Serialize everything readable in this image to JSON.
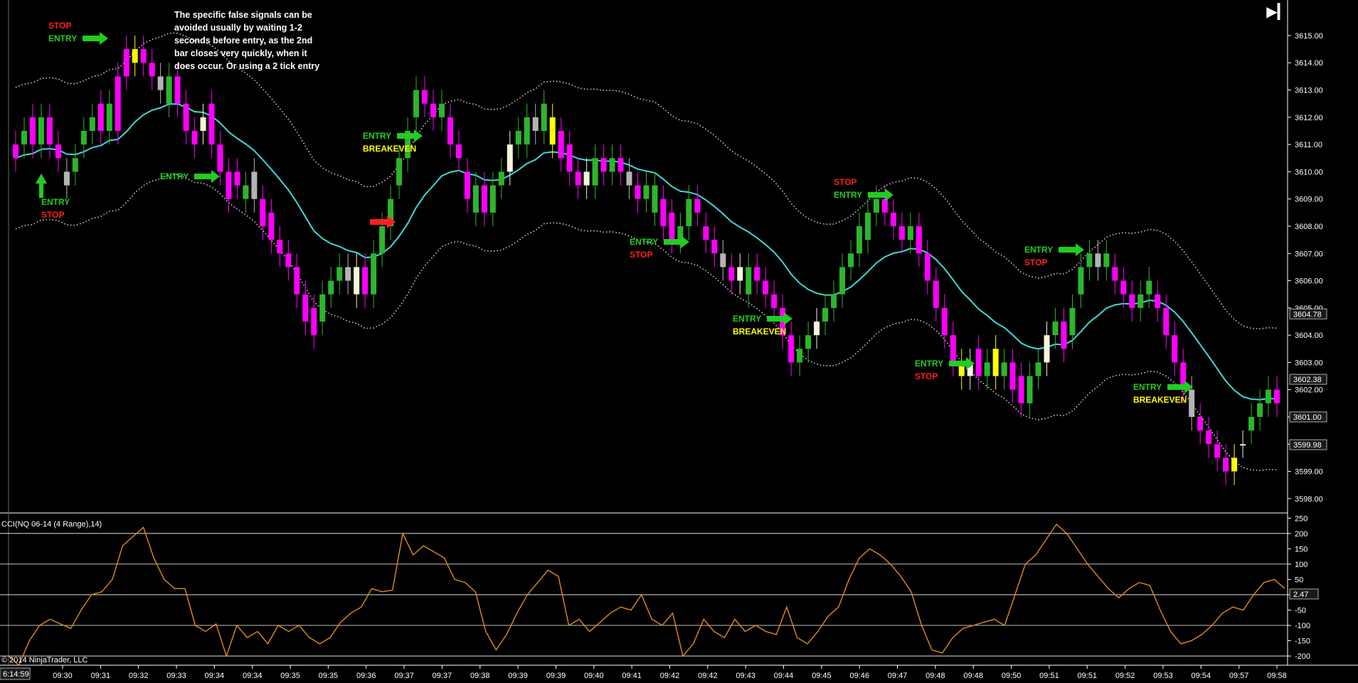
{
  "note_lines": [
    "The specific false signals can be",
    "avoided usually by waiting 1-2",
    "seconds before entry, as the 2nd",
    "bar closes very quickly, when it",
    "does occur.  Or using a 2 tick entry"
  ],
  "copyright": "© 2014 NinjaTrader, LLC",
  "clock": "6:14:59",
  "colors": {
    "bull": "#2db52d",
    "bear": "#ff00ff",
    "neutral_up": "#f5f5dc",
    "neutral_down": "#b4b4b4",
    "signal_bar": "#ffff00",
    "ema": "#40d8d8",
    "bands": "#d0d0d0",
    "cci": "#e08a1e",
    "entry": "#22cc22",
    "stop": "#ff2020",
    "breakeven": "#ffff00",
    "arrow_red": "#ff2020"
  },
  "annotations": [
    {
      "lines": [
        "STOP",
        "ENTRY"
      ],
      "colors": [
        "stop",
        "entry"
      ],
      "arrow": "right"
    },
    {
      "lines": [
        "ENTRY",
        "STOP"
      ],
      "colors": [
        "entry",
        "stop"
      ],
      "arrow": "up"
    },
    {
      "lines": [
        "ENTRY"
      ],
      "colors": [
        "entry"
      ],
      "arrow": "right"
    },
    {
      "lines": [
        "ENTRY",
        "BREAKEVEN"
      ],
      "colors": [
        "entry",
        "breakeven"
      ],
      "arrow": "right"
    },
    {
      "lines": [
        ""
      ],
      "colors": [
        "stop"
      ],
      "arrow": "right-red"
    },
    {
      "lines": [
        "ENTRY",
        "STOP"
      ],
      "colors": [
        "entry",
        "stop"
      ],
      "arrow": "right"
    },
    {
      "lines": [
        "ENTRY",
        "BREAKEVEN"
      ],
      "colors": [
        "entry",
        "breakeven"
      ],
      "arrow": "right"
    },
    {
      "lines": [
        "STOP",
        "ENTRY"
      ],
      "colors": [
        "stop",
        "entry"
      ],
      "arrow": "right"
    },
    {
      "lines": [
        "ENTRY",
        "STOP"
      ],
      "colors": [
        "entry",
        "stop"
      ],
      "arrow": "right"
    },
    {
      "lines": [
        "ENTRY",
        "STOP"
      ],
      "colors": [
        "entry",
        "stop"
      ],
      "arrow": "right"
    },
    {
      "lines": [
        "ENTRY",
        "BREAKEVEN"
      ],
      "colors": [
        "entry",
        "breakeven"
      ],
      "arrow": "right"
    }
  ],
  "chart_data": [
    {
      "type": "candlestick",
      "title": "",
      "ylim": [
        3597.5,
        3616.2
      ],
      "y_ticks": [
        3598.0,
        3599.0,
        3600.0,
        3601.0,
        3602.0,
        3603.0,
        3604.0,
        3605.0,
        3606.0,
        3607.0,
        3608.0,
        3609.0,
        3610.0,
        3611.0,
        3612.0,
        3613.0,
        3614.0,
        3615.0
      ],
      "price_markers": [
        3604.78,
        3602.38,
        3601.0,
        3599.98
      ],
      "x_ticks": [
        "09:30",
        "09:31",
        "09:32",
        "09:33",
        "09:34",
        "09:34",
        "09:35",
        "09:35",
        "09:36",
        "09:37",
        "09:37",
        "09:38",
        "09:39",
        "09:39",
        "09:40",
        "09:41",
        "09:42",
        "09:42",
        "09:43",
        "09:44",
        "09:45",
        "09:46",
        "09:47",
        "09:48",
        "09:48",
        "09:50",
        "09:51",
        "09:51",
        "09:52",
        "09:53",
        "09:54",
        "09:57",
        "09:58"
      ],
      "candles_close": [
        3610.5,
        3611.5,
        3611.0,
        3612.0,
        3611.0,
        3610.5,
        3609.5,
        3610.5,
        3611.5,
        3612.0,
        3611.5,
        3612.5,
        3611.5,
        3613.5,
        3614.5,
        3614.0,
        3613.5,
        3613.0,
        3613.5,
        3612.5,
        3611.5,
        3611.0,
        3612.0,
        3611.0,
        3610.0,
        3609.0,
        3609.5,
        3609.5,
        3609.0,
        3608.0,
        3607.5,
        3607.0,
        3606.5,
        3605.5,
        3604.5,
        3604.0,
        3605.5,
        3606.0,
        3606.5,
        3606.0,
        3606.5,
        3605.5,
        3607.0,
        3608.0,
        3609.0,
        3610.5,
        3611.5,
        3613.0,
        3612.5,
        3612.0,
        3612.5,
        3611.0,
        3610.5,
        3609.0,
        3609.5,
        3608.5,
        3609.5,
        3610.0,
        3611.0,
        3611.5,
        3612.0,
        3611.5,
        3612.5,
        3611.0,
        3610.5,
        3610.0,
        3609.5,
        3610.0,
        3610.5,
        3610.0,
        3610.5,
        3610.0,
        3609.5,
        3609.0,
        3609.5,
        3609.5,
        3608.0,
        3607.5,
        3608.0,
        3609.0,
        3608.5,
        3607.5,
        3607.0,
        3606.5,
        3606.0,
        3606.5,
        3606.5,
        3606.0,
        3605.5,
        3605.0,
        3604.0,
        3603.0,
        3603.5,
        3604.0,
        3604.5,
        3605.0,
        3605.5,
        3606.5,
        3607.0,
        3608.0,
        3608.5,
        3609.0,
        3608.5,
        3608.0,
        3607.5,
        3608.0,
        3607.0,
        3606.0,
        3605.0,
        3604.0,
        3603.0,
        3602.5,
        3603.0,
        3602.5,
        3603.0,
        3602.5,
        3603.0,
        3602.0,
        3601.5,
        3602.5,
        3603.0,
        3604.0,
        3604.5,
        3603.5,
        3605.0,
        3606.5,
        3607.0,
        3606.5,
        3607.0,
        3606.0,
        3605.5,
        3605.0,
        3605.5,
        3606.0,
        3605.0,
        3604.0,
        3603.0,
        3602.0,
        3601.0,
        3600.5,
        3600.0,
        3599.5,
        3599.0,
        3599.5,
        3600.0,
        3601.0,
        3601.5,
        3602.0,
        3601.5
      ],
      "candles_open": [
        3611.0,
        3611.0,
        3612.0,
        3611.0,
        3612.0,
        3611.0,
        3610.0,
        3610.0,
        3611.0,
        3611.5,
        3612.5,
        3611.5,
        3613.5,
        3614.5,
        3614.0,
        3614.5,
        3614.0,
        3613.5,
        3612.5,
        3613.5,
        3612.5,
        3611.5,
        3611.5,
        3612.5,
        3611.0,
        3610.0,
        3610.0,
        3609.0,
        3610.0,
        3609.0,
        3608.5,
        3607.5,
        3607.0,
        3606.5,
        3605.5,
        3605.0,
        3604.5,
        3605.5,
        3606.0,
        3606.5,
        3605.5,
        3606.5,
        3605.5,
        3607.0,
        3608.0,
        3609.5,
        3610.5,
        3612.0,
        3613.0,
        3612.5,
        3612.0,
        3612.0,
        3611.0,
        3610.0,
        3608.5,
        3609.5,
        3608.5,
        3609.5,
        3610.0,
        3611.0,
        3611.0,
        3612.0,
        3611.5,
        3612.0,
        3611.5,
        3611.0,
        3610.0,
        3609.5,
        3609.5,
        3610.5,
        3610.0,
        3610.5,
        3610.0,
        3609.5,
        3609.0,
        3608.5,
        3609.0,
        3608.5,
        3607.5,
        3608.0,
        3609.0,
        3608.0,
        3607.5,
        3607.0,
        3606.5,
        3606.0,
        3605.5,
        3606.5,
        3606.0,
        3605.5,
        3605.0,
        3604.0,
        3603.0,
        3603.5,
        3604.0,
        3604.5,
        3605.0,
        3605.5,
        3606.5,
        3607.0,
        3607.5,
        3608.5,
        3609.0,
        3608.5,
        3608.0,
        3607.5,
        3608.0,
        3607.0,
        3606.0,
        3605.0,
        3604.0,
        3603.0,
        3602.5,
        3603.5,
        3602.5,
        3603.5,
        3602.5,
        3603.0,
        3602.5,
        3601.5,
        3602.5,
        3603.0,
        3604.0,
        3604.5,
        3604.0,
        3605.5,
        3606.5,
        3607.0,
        3606.5,
        3606.5,
        3606.0,
        3605.5,
        3605.0,
        3605.5,
        3605.5,
        3605.0,
        3604.0,
        3603.0,
        3602.0,
        3601.0,
        3600.5,
        3600.0,
        3599.5,
        3599.0,
        3600.0,
        3600.5,
        3601.0,
        3601.5,
        3602.0
      ]
    },
    {
      "type": "line",
      "title": "CCI(NQ 06-14 (4 Range),14)",
      "ylim": [
        -230,
        260
      ],
      "y_ticks": [
        -200,
        -150,
        -100,
        -50,
        0,
        50,
        100,
        150,
        200,
        250
      ],
      "last_value_marker": "2.47",
      "series": [
        {
          "name": "CCI",
          "values": [
            -200,
            -230,
            -150,
            -100,
            -80,
            -95,
            -110,
            -50,
            0,
            10,
            50,
            160,
            190,
            220,
            120,
            50,
            20,
            20,
            -100,
            -120,
            -95,
            -200,
            -100,
            -140,
            -120,
            -160,
            -100,
            -120,
            -100,
            -140,
            -160,
            -140,
            -90,
            -60,
            -40,
            20,
            10,
            15,
            200,
            130,
            160,
            140,
            120,
            50,
            40,
            10,
            -120,
            -180,
            -130,
            -60,
            0,
            40,
            80,
            60,
            -100,
            -80,
            -120,
            -90,
            -60,
            -40,
            -50,
            0,
            -80,
            -100,
            -60,
            -200,
            -160,
            -80,
            -120,
            -140,
            -80,
            -120,
            -100,
            -120,
            -130,
            -40,
            -140,
            -160,
            -120,
            -70,
            -40,
            50,
            120,
            150,
            130,
            100,
            60,
            10,
            -100,
            -180,
            -190,
            -140,
            -110,
            -100,
            -90,
            -80,
            -100,
            0,
            100,
            130,
            180,
            230,
            200,
            150,
            100,
            60,
            20,
            -10,
            20,
            40,
            30,
            -50,
            -120,
            -160,
            -150,
            -130,
            -100,
            -60,
            -40,
            -50,
            0,
            40,
            50,
            20
          ]
        }
      ]
    }
  ]
}
